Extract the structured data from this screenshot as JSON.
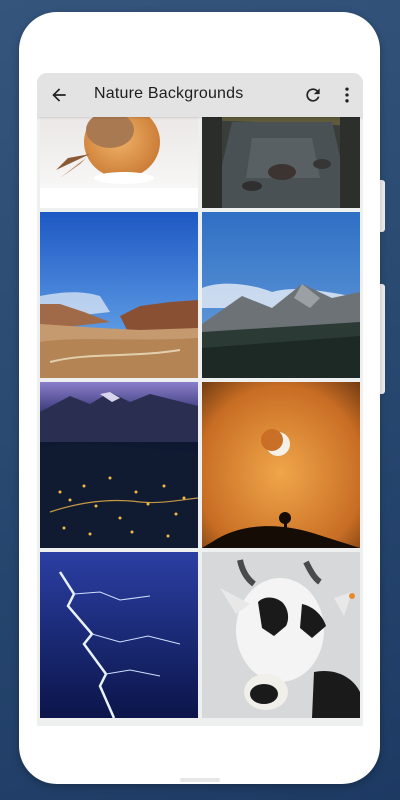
{
  "appbar": {
    "title": "Nature Backgrounds",
    "back_icon": "arrow-left-icon",
    "refresh_icon": "refresh-icon",
    "more_icon": "more-vert-icon"
  },
  "gallery": {
    "images": [
      {
        "name": "robin-in-snow"
      },
      {
        "name": "stream-rocks"
      },
      {
        "name": "desert-canyon"
      },
      {
        "name": "mountain-blue-sky"
      },
      {
        "name": "city-lights-night"
      },
      {
        "name": "moon-orange-sky"
      },
      {
        "name": "lightning-storm"
      },
      {
        "name": "goat-portrait"
      }
    ]
  },
  "colors": {
    "appbar_bg": "#e3e3e3",
    "background": "#2a4a72"
  }
}
